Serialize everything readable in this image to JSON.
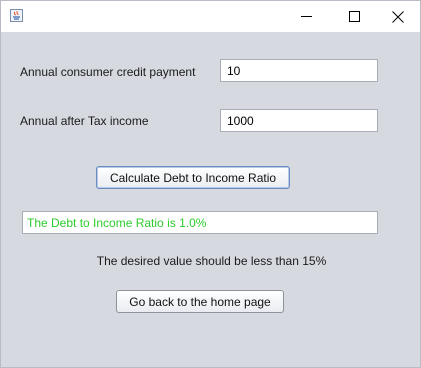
{
  "window": {
    "controls": {
      "minimize_icon": "minimize-icon",
      "maximize_icon": "maximize-icon",
      "close_icon": "close-icon"
    }
  },
  "form": {
    "credit_label": "Annual consumer credit payment",
    "credit_value": "10",
    "income_label": "Annual after Tax income",
    "income_value": "1000"
  },
  "actions": {
    "calculate_label": "Calculate Debt to Income Ratio",
    "home_label": "Go back to the home page"
  },
  "result": {
    "text": "The Debt to Income Ratio is 1.0%",
    "color": "#2ecc2e"
  },
  "hint": "The desired value should be less than 15%"
}
